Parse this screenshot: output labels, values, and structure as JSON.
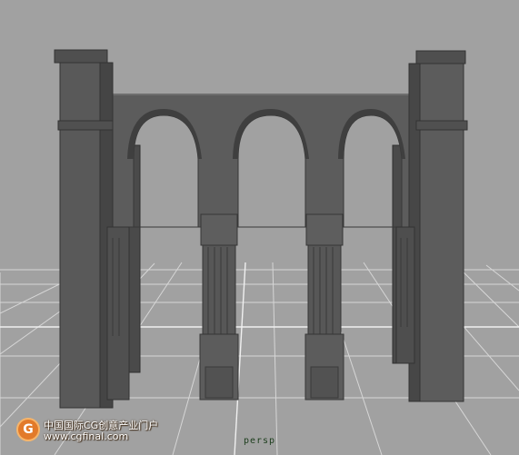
{
  "viewport": {
    "camera_label": "persp",
    "background_color": "#a1a1a1",
    "grid_color": "#dcdcdc",
    "model_color": "#5a5a5a",
    "model_shadow_color": "#3e3e3e"
  },
  "watermark": {
    "line1": "中国国际CG创意产业门户",
    "line2": "www.cgfinal.com",
    "logo_glyph": "G",
    "logo_color": "#e27a2a"
  }
}
